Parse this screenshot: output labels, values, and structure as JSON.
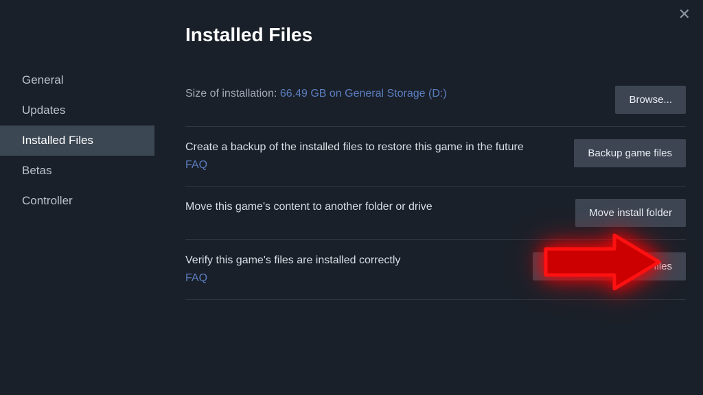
{
  "sidebar": {
    "items": [
      {
        "label": "General"
      },
      {
        "label": "Updates"
      },
      {
        "label": "Installed Files"
      },
      {
        "label": "Betas"
      },
      {
        "label": "Controller"
      }
    ],
    "activeIndex": 2
  },
  "main": {
    "title": "Installed Files",
    "sizeRow": {
      "label": "Size of installation:",
      "value": "66.49 GB on General Storage (D:)",
      "button": "Browse..."
    },
    "backupRow": {
      "text": "Create a backup of the installed files to restore this game in the future",
      "faq": "FAQ",
      "button": "Backup game files"
    },
    "moveRow": {
      "text": "Move this game's content to another folder or drive",
      "button": "Move install folder"
    },
    "verifyRow": {
      "text": "Verify this game's files are installed correctly",
      "faq": "FAQ",
      "button": "Verify integrity of game files"
    }
  }
}
